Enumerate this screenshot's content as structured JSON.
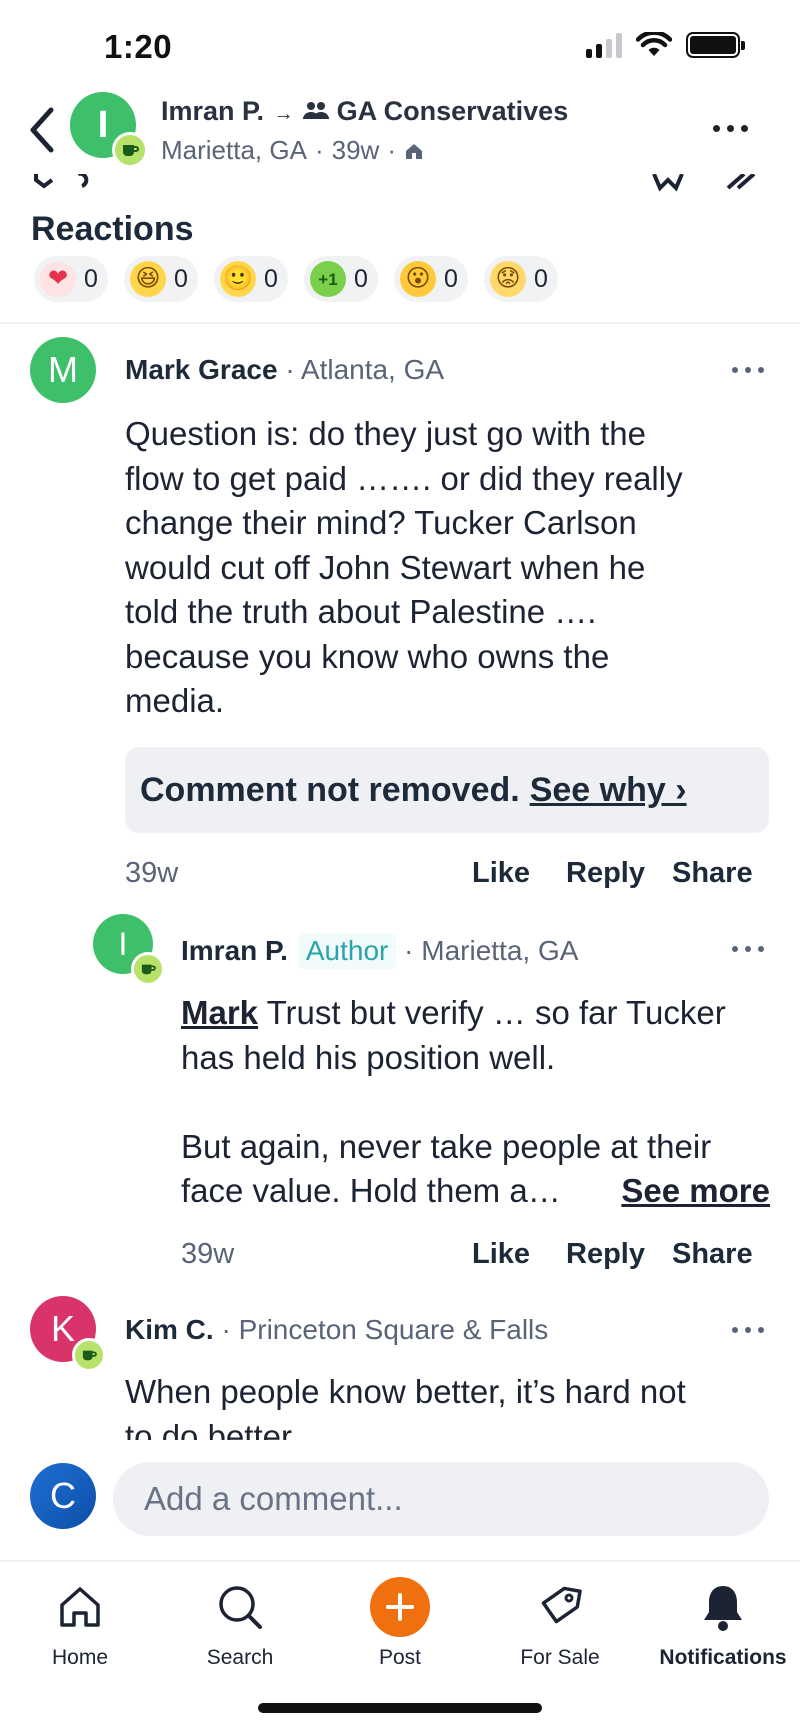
{
  "status_bar": {
    "time": "1:20"
  },
  "header": {
    "avatar_letter": "I",
    "author": "Imran P.",
    "arrow": "→",
    "group": "GA Conservatives",
    "location": "Marietta, GA",
    "age": "39w"
  },
  "reactions": {
    "title": "Reactions",
    "items": [
      {
        "name": "heart",
        "glyph": "❤",
        "count": "0",
        "bg": "#fde3e3",
        "color": "#e5334f"
      },
      {
        "name": "laugh",
        "glyph": "😆",
        "count": "0",
        "bg": "#ffd64a",
        "color": "#7a4a00"
      },
      {
        "name": "smile",
        "glyph": "🙂",
        "count": "0",
        "bg": "#ffd64a",
        "color": "#7a4a00"
      },
      {
        "name": "plus-one",
        "glyph": "+1",
        "count": "0",
        "bg": "#7bd04b",
        "color": "#1d5c14"
      },
      {
        "name": "wow",
        "glyph": "😮",
        "count": "0",
        "bg": "#ffc93a",
        "color": "#7a4a00"
      },
      {
        "name": "sad",
        "glyph": "😟",
        "count": "0",
        "bg": "#ffd86b",
        "color": "#7a4a00"
      }
    ]
  },
  "comments": [
    {
      "avatar_letter": "M",
      "avatar_color": "#3ec06a",
      "name": "Mark Grace",
      "location": "· Atlanta, GA",
      "body_lines": [
        "Question is: do they just go with the",
        "flow to get paid ……. or did they really",
        "change their mind? Tucker Carlson",
        "would cut off John Stewart when he",
        "told the truth about Palestine ….",
        "because you know who owns the",
        "media."
      ],
      "notice_text": "Comment not removed.",
      "notice_link": "See why ›",
      "age": "39w",
      "actions": {
        "like": "Like",
        "reply": "Reply",
        "share": "Share"
      }
    },
    {
      "avatar_letter": "I",
      "avatar_color": "#3ec06a",
      "name": "Imran P.",
      "author_tag": "Author",
      "location": "· Marietta, GA",
      "mention": "Mark",
      "line1_rest": " Trust but verify … so far Tucker",
      "line2": "has held his position well.",
      "line3": "But again, never take people at their",
      "line4": "face value. Hold them a…",
      "see_more": "See more",
      "age": "39w",
      "actions": {
        "like": "Like",
        "reply": "Reply",
        "share": "Share"
      }
    },
    {
      "avatar_letter": "K",
      "avatar_color": "#d8346a",
      "name": "Kim C.",
      "location": "· Princeton Square & Falls",
      "line1": "When people know better, it’s hard not",
      "line2": "to do better."
    }
  ],
  "composer": {
    "avatar_letter": "C",
    "placeholder": "Add a comment..."
  },
  "nav": {
    "home": "Home",
    "search": "Search",
    "post": "Post",
    "for_sale": "For Sale",
    "notifications": "Notifications"
  }
}
